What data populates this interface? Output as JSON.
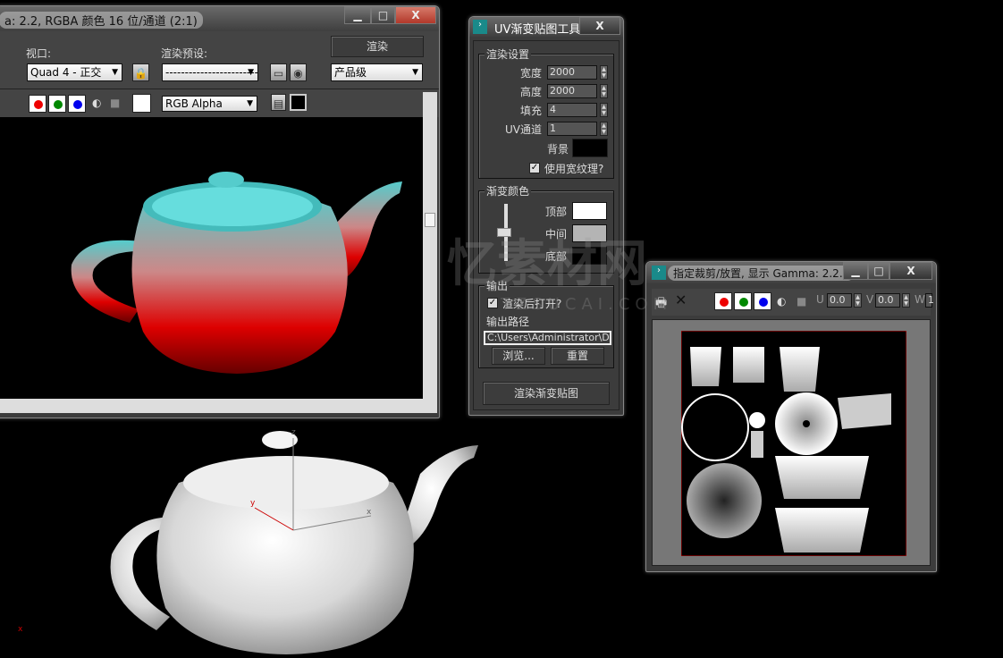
{
  "render_window": {
    "title": "a: 2.2, RGBA 颜色 16 位/通道 (2:1)",
    "viewport_label": "视口:",
    "viewport_value": "Quad 4 - 正交",
    "preset_label": "渲染预设:",
    "preset_value": "------------------------",
    "render_button": "渲染",
    "quality_value": "产品级",
    "channel_value": "RGB Alpha"
  },
  "uv_tool": {
    "title": "UV渐变贴图工具",
    "render_settings": {
      "group": "渲染设置",
      "width_label": "宽度",
      "width": "2000",
      "height_label": "高度",
      "height": "2000",
      "padding_label": "填充",
      "padding": "4",
      "uv_label": "UV通道",
      "uv": "1",
      "bg_label": "背景",
      "wide_texture_label": "使用宽纹理?"
    },
    "gradient": {
      "group": "渐变颜色",
      "top": "顶部",
      "middle": "中间",
      "bottom": "底部",
      "colors": {
        "top": "#ffffff",
        "middle": "#b4b4b4",
        "bottom": "#000000"
      }
    },
    "output": {
      "group": "输出",
      "open_after": "渲染后打开?",
      "path_label": "输出路径",
      "path": "C:\\Users\\Administrator\\Des",
      "browse": "浏览...",
      "reset": "重置"
    },
    "render_map_button": "渲染渐变贴图"
  },
  "crop_window": {
    "title": "指定裁剪/放置, 显示 Gamma: 2.2...",
    "u_label": "U",
    "u": "0.0",
    "v_label": "V",
    "v": "0.0",
    "w_label": "W",
    "w": "1"
  },
  "watermark": {
    "text": "TZSUCAI.COM",
    "cn": "忆素材网"
  },
  "window_buttons": {
    "min": "▁",
    "max": "□",
    "close": "X"
  }
}
